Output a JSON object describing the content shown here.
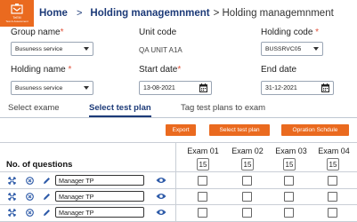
{
  "logo": {
    "line1": "TeEM",
    "line2": "Test & Assessment"
  },
  "breadcrumb": {
    "home": "Home",
    "separator": ">",
    "middle": "Holding managemnment",
    "current": "> Holding managemnment"
  },
  "form": {
    "group_name": {
      "label": "Group name",
      "required_mark": "*",
      "value": "Busuness service"
    },
    "unit_code": {
      "label": "Unit code",
      "value": "QA UNIT A1A"
    },
    "holding_code": {
      "label": "Holding code",
      "required_mark": "*",
      "value": "BUSSRVC05"
    },
    "holding_name": {
      "label": "Holding name",
      "required_mark": "*",
      "value": "Busuness service"
    },
    "start_date": {
      "label": "Start date",
      "required_mark": "*",
      "value": "13-08-2021"
    },
    "end_date": {
      "label": "End date",
      "value": "31-12-2021"
    }
  },
  "tabs": [
    {
      "label": "Select exame",
      "active": false
    },
    {
      "label": "Select test plan",
      "active": true
    },
    {
      "label": "Tag test plans to exam",
      "active": false
    }
  ],
  "actions": {
    "export": "Export",
    "select_test_plan": "Select test plan",
    "opration_schedule": "Opration Schdule"
  },
  "table": {
    "questions_header": "No. of questions",
    "exams": [
      {
        "name": "Exam 01",
        "count": "15"
      },
      {
        "name": "Exam 02",
        "count": "15"
      },
      {
        "name": "Exam 03",
        "count": "15"
      },
      {
        "name": "Exam 04",
        "count": "15"
      }
    ],
    "rows": [
      {
        "test_plan": "Manager TP"
      },
      {
        "test_plan": "Manager TP"
      },
      {
        "test_plan": "Manager TP"
      }
    ]
  },
  "colors": {
    "accent": "#ea6a1f",
    "primary": "#1c3a78",
    "icon": "#2d5aa8"
  }
}
